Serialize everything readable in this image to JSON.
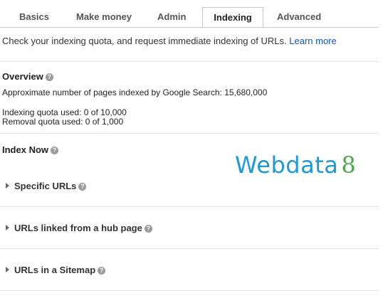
{
  "tabs": [
    {
      "label": "Basics",
      "active": false
    },
    {
      "label": "Make money",
      "active": false
    },
    {
      "label": "Admin",
      "active": false
    },
    {
      "label": "Indexing",
      "active": true
    },
    {
      "label": "Advanced",
      "active": false
    }
  ],
  "intro": {
    "text": "Check your indexing quota, and request immediate indexing of URLs.",
    "link": "Learn more"
  },
  "overview": {
    "title": "Overview",
    "pages_indexed": "Approximate number of pages indexed by Google Search: 15,680,000",
    "indexing_quota": "Indexing quota used: 0 of 10,000",
    "removal_quota": "Removal quota used: 0 of 1,000"
  },
  "index_now": {
    "title": "Index Now",
    "sections": [
      {
        "label": "Specific URLs"
      },
      {
        "label": "URLs linked from a hub page"
      },
      {
        "label": "URLs in a Sitemap"
      }
    ]
  },
  "watermark": {
    "word": "Webdata",
    "number": "8"
  },
  "colors": {
    "link": "#1155cc",
    "watermark_word": "#1a9ad6",
    "watermark_number": "#4aa84a"
  },
  "icons": {
    "help": "question-circle-icon",
    "expand": "triangle-right-icon"
  }
}
